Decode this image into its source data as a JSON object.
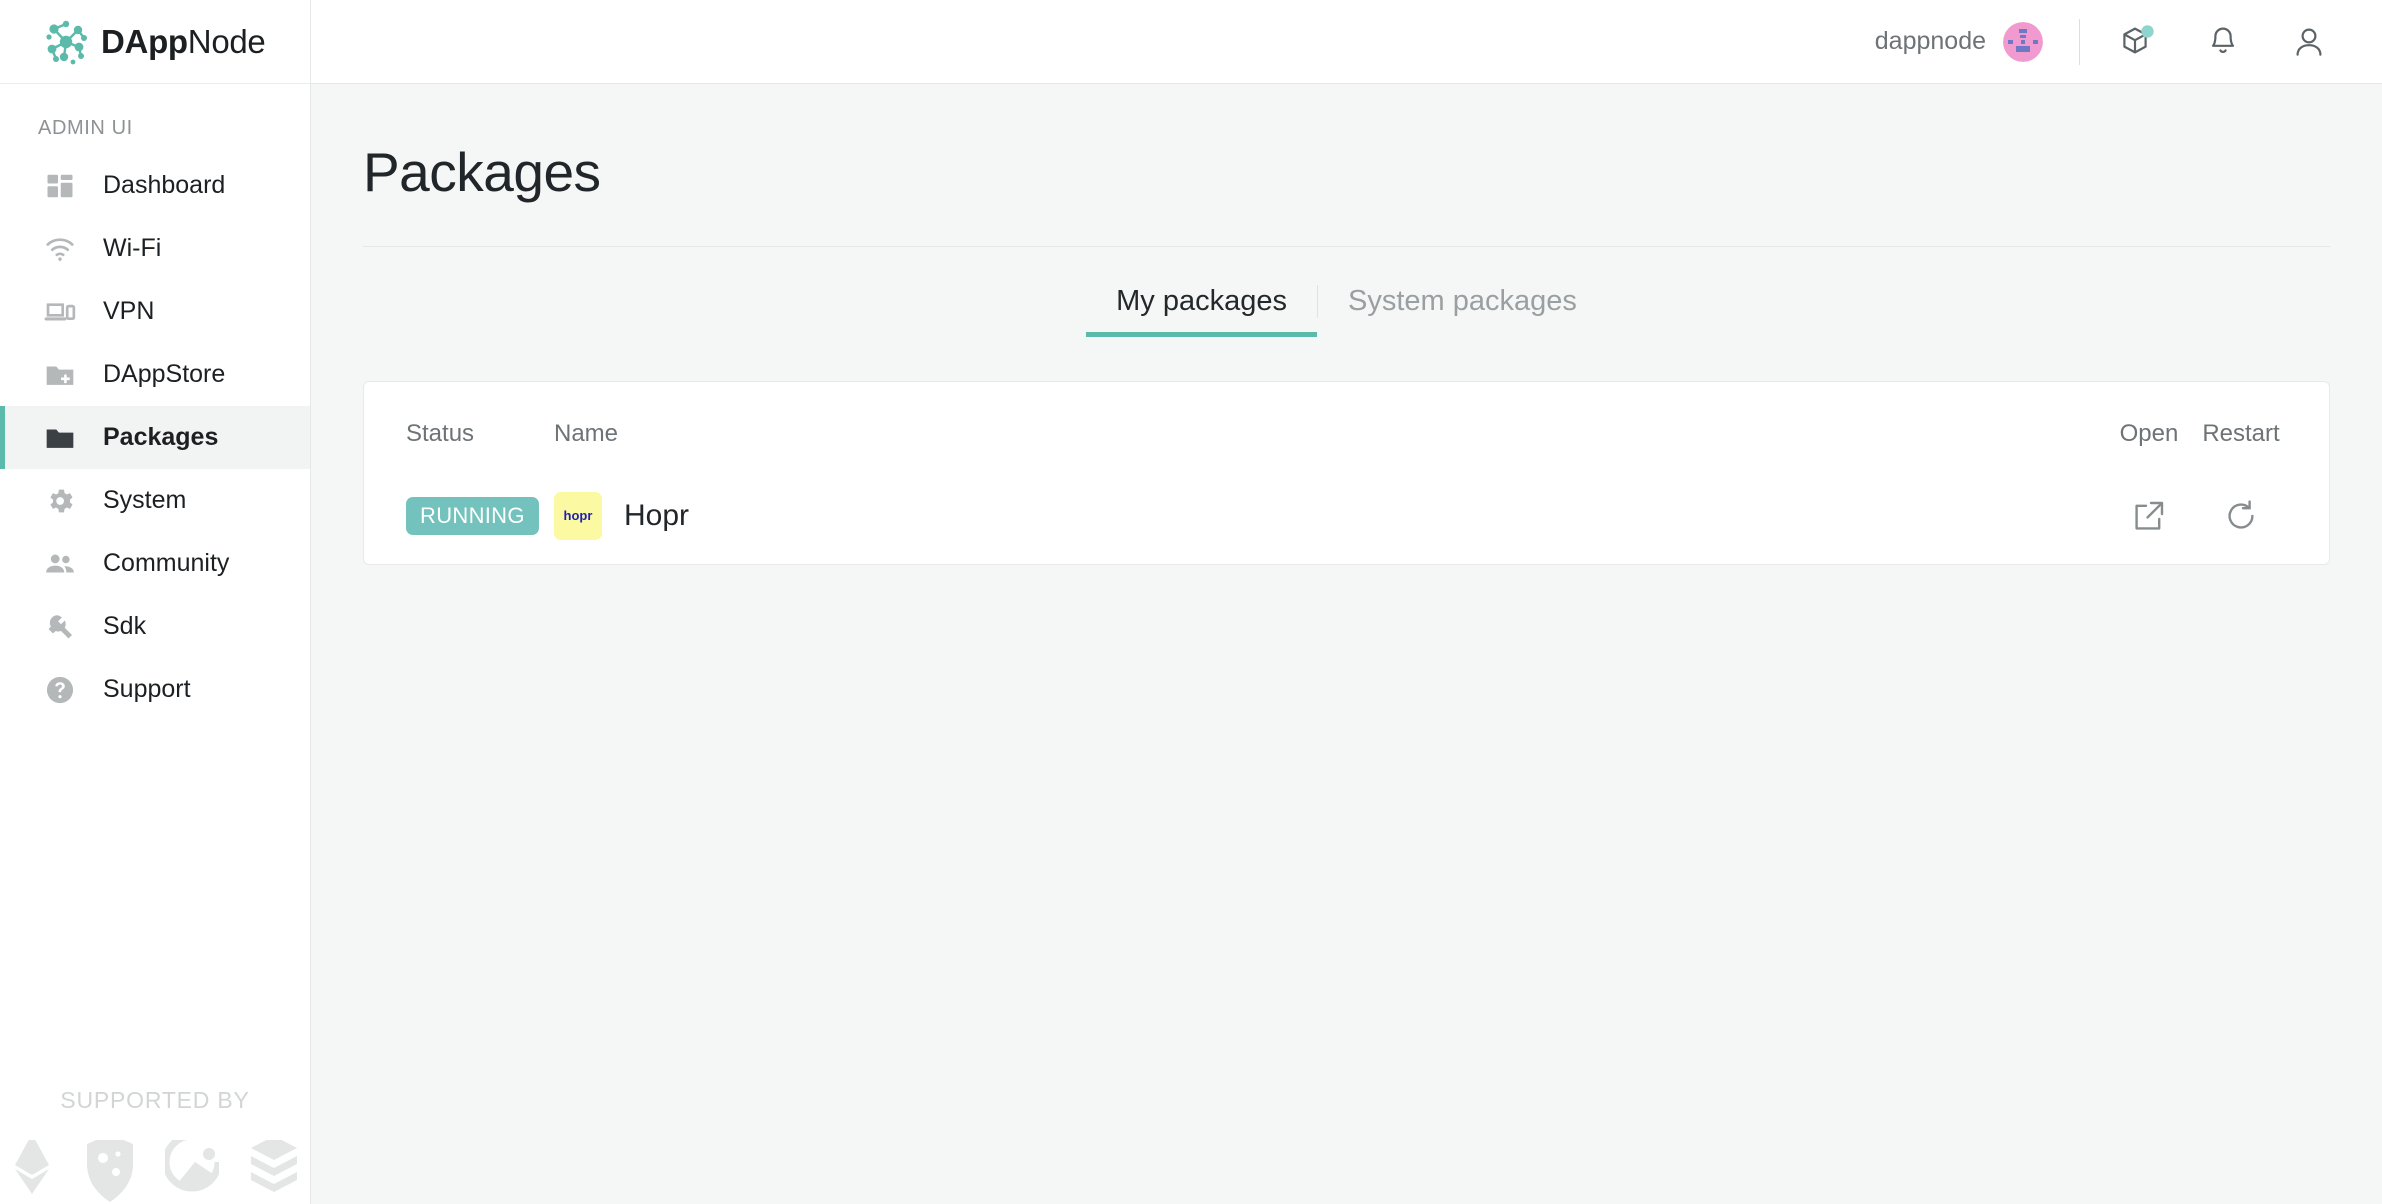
{
  "brand": {
    "name_bold": "DApp",
    "name_light": "Node",
    "logo_icon": "dappnode-molecule-logo"
  },
  "sidebar": {
    "section_label": "ADMIN UI",
    "items": [
      {
        "label": "Dashboard",
        "icon": "dashboard-icon",
        "active": false
      },
      {
        "label": "Wi-Fi",
        "icon": "wifi-icon",
        "active": false
      },
      {
        "label": "VPN",
        "icon": "devices-icon",
        "active": false
      },
      {
        "label": "DAppStore",
        "icon": "folder-add-icon",
        "active": false
      },
      {
        "label": "Packages",
        "icon": "folder-icon",
        "active": true
      },
      {
        "label": "System",
        "icon": "gear-icon",
        "active": false
      },
      {
        "label": "Community",
        "icon": "people-icon",
        "active": false
      },
      {
        "label": "Sdk",
        "icon": "wrench-icon",
        "active": false
      },
      {
        "label": "Support",
        "icon": "help-circle-icon",
        "active": false
      }
    ],
    "supported_by": {
      "label": "SUPPORTED BY",
      "logos": [
        "ethereum-logo",
        "gnosis-logo",
        "aragon-logo",
        "giveth-blocks-logo"
      ]
    }
  },
  "topbar": {
    "user_name": "dappnode",
    "avatar_icon": "user-identicon-avatar",
    "icons": [
      {
        "name": "cube-icon",
        "has_badge": true
      },
      {
        "name": "bell-icon",
        "has_badge": false
      },
      {
        "name": "account-icon",
        "has_badge": false
      }
    ]
  },
  "main": {
    "page_title": "Packages",
    "tabs": [
      {
        "label": "My packages",
        "active": true
      },
      {
        "label": "System packages",
        "active": false
      }
    ],
    "table": {
      "headers": {
        "status": "Status",
        "name": "Name",
        "open": "Open",
        "restart": "Restart"
      },
      "rows": [
        {
          "status": "RUNNING",
          "name": "Hopr",
          "logo_text": "hopr",
          "logo_icon": "hopr-logo",
          "open_icon": "external-link-icon",
          "restart_icon": "refresh-icon"
        }
      ]
    }
  },
  "colors": {
    "accent_teal": "#5bbaaa",
    "badge_teal": "#73c2bd",
    "page_bg": "#f5f7f6",
    "card_bg": "#ffffff",
    "hopr_yellow": "#fbfaa2",
    "hopr_blue": "#1f1fb0",
    "avatar_pink": "#f09ad0"
  }
}
